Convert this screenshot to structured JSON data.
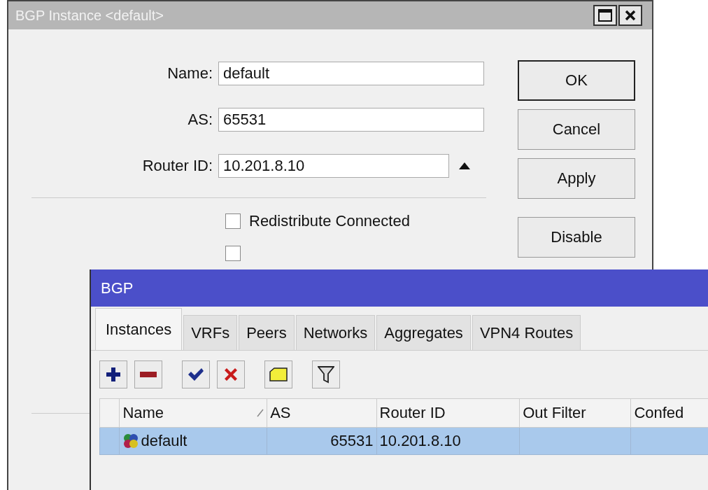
{
  "instance_window": {
    "title": "BGP Instance <default>",
    "fields": [
      {
        "label": "Name:",
        "value": "default",
        "kind": "text"
      },
      {
        "label": "AS:",
        "value": "65531",
        "kind": "text"
      },
      {
        "label": "Router ID:",
        "value": "10.201.8.10",
        "kind": "collapsible"
      }
    ],
    "checkboxes": [
      {
        "label": "Redistribute Connected",
        "checked": false
      },
      {
        "checked": false
      }
    ],
    "buttons": [
      {
        "label": "OK",
        "selected": true
      },
      {
        "label": "Cancel",
        "selected": false
      },
      {
        "label": "Apply",
        "selected": false
      },
      {
        "label": "Disable",
        "selected": false
      }
    ]
  },
  "bgp_window": {
    "title": "BGP",
    "tabs": [
      {
        "label": "Instances",
        "selected": true
      },
      {
        "label": "VRFs",
        "selected": false
      },
      {
        "label": "Peers",
        "selected": false
      },
      {
        "label": "Networks",
        "selected": false
      },
      {
        "label": "Aggregates",
        "selected": false
      },
      {
        "label": "VPN4 Routes",
        "selected": false
      }
    ],
    "toolbar": [
      {
        "kind": "add"
      },
      {
        "kind": "remove"
      },
      {
        "kind": "enable"
      },
      {
        "kind": "disable"
      },
      {
        "kind": "comment"
      },
      {
        "kind": "filter"
      }
    ],
    "table": {
      "columns": [
        "Name",
        "AS",
        "Router ID",
        "Out Filter",
        "Confed"
      ],
      "rows": [
        {
          "selected": true,
          "cells": [
            "default",
            "65531",
            "10.201.8.10",
            "",
            ""
          ]
        }
      ]
    }
  }
}
